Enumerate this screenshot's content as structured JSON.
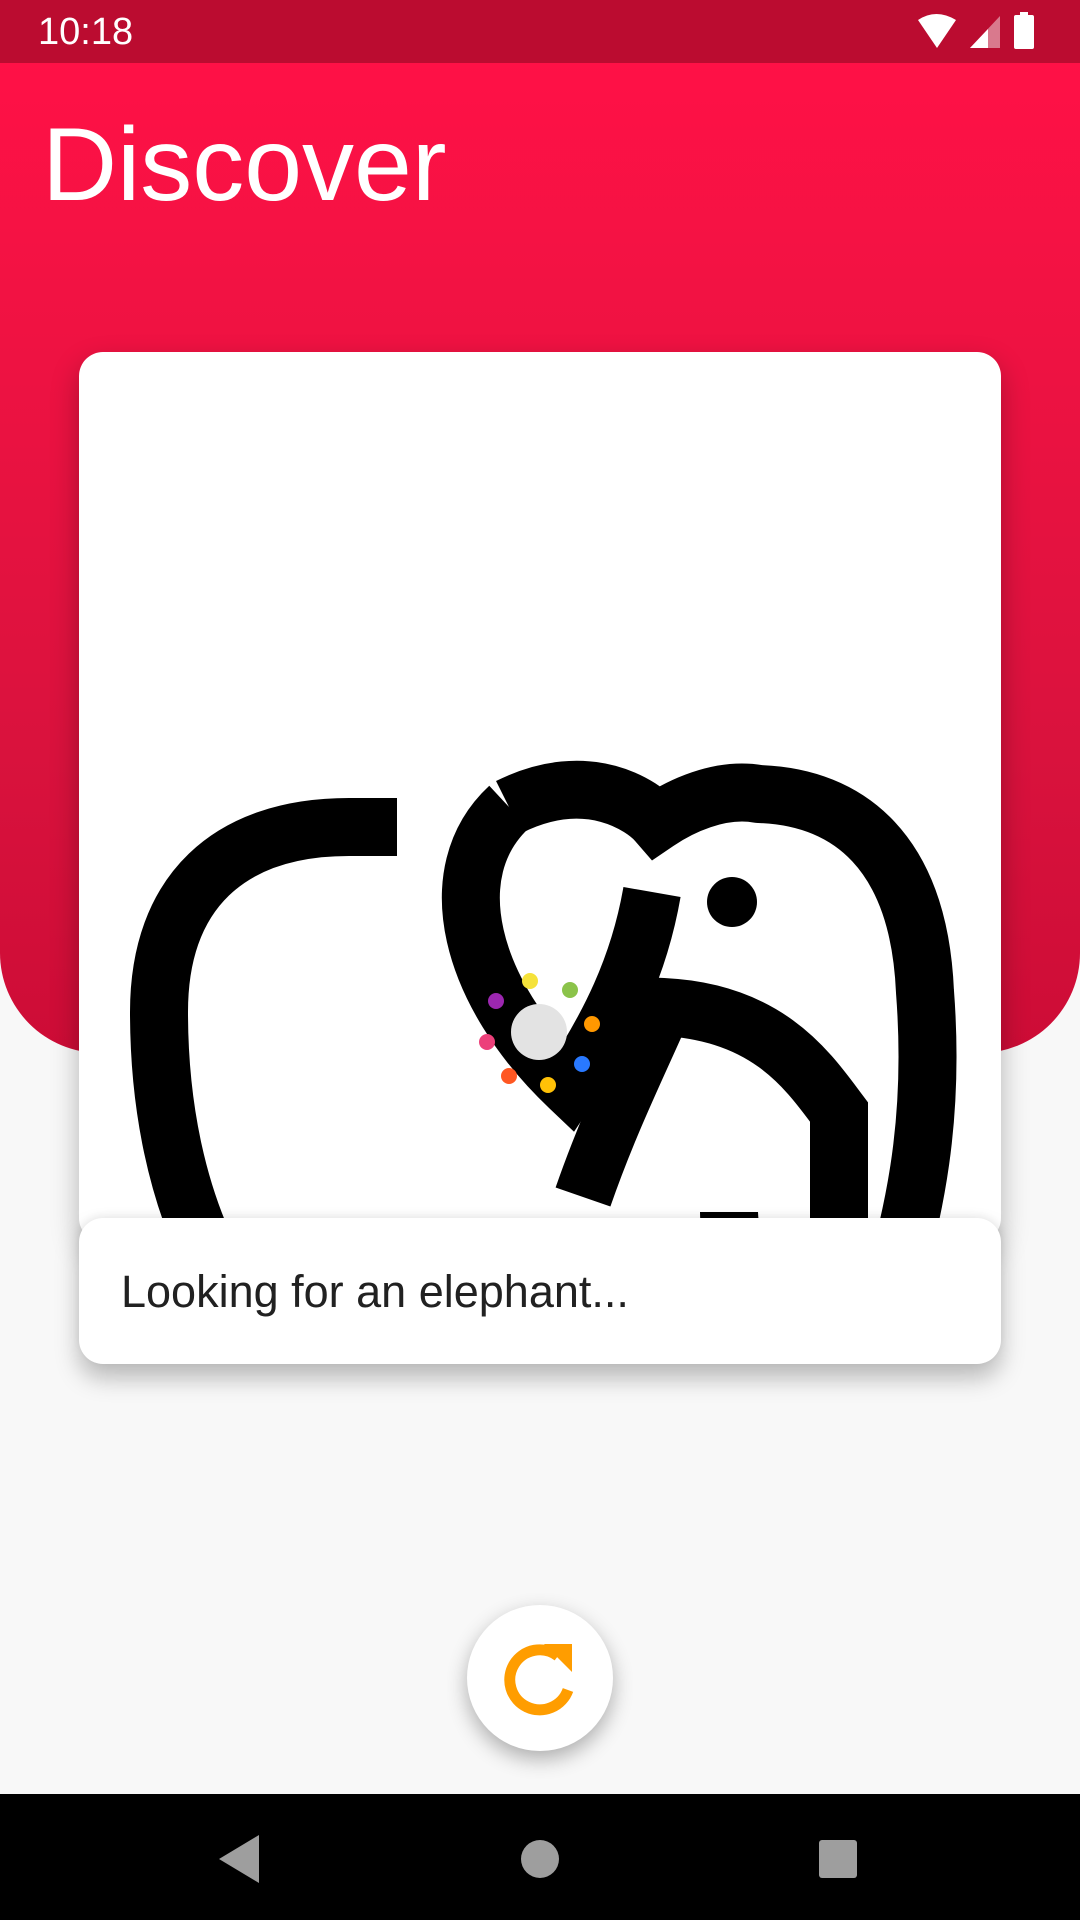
{
  "status_bar": {
    "time": "10:18",
    "icons": [
      "wifi-icon",
      "cell-signal-icon",
      "battery-icon"
    ]
  },
  "header": {
    "title": "Discover",
    "gradient_top": "#ff1146",
    "gradient_bottom": "#cd0c36",
    "status_bar_color": "#bb0c30"
  },
  "result": {
    "image_icon": "elephant-icon",
    "caption": "Looking for an elephant..."
  },
  "loading_indicator": {
    "dot_colors": [
      "#f5e23a",
      "#8bc34a",
      "#ff9800",
      "#2979ff",
      "#ffc107",
      "#ff5722",
      "#ec407a",
      "#9c27b0"
    ]
  },
  "refresh_button": {
    "icon": "refresh-icon",
    "color": "#ff9d00"
  },
  "nav_bar": {
    "buttons": [
      "back-icon",
      "home-icon",
      "recents-icon"
    ]
  }
}
